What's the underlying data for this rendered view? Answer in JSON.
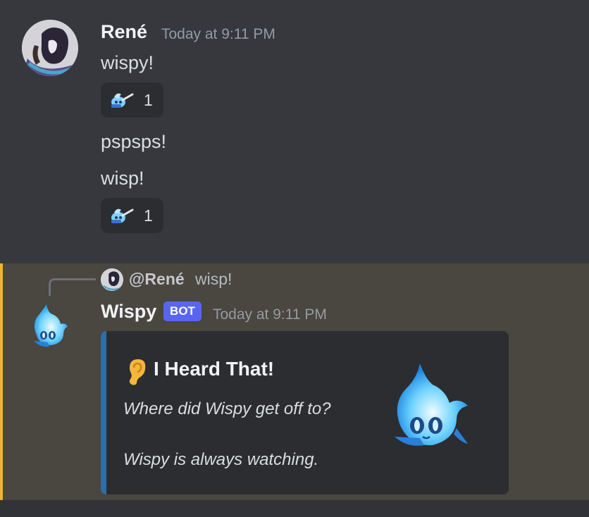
{
  "messages": [
    {
      "author": "René",
      "timestamp": "Today at 9:11 PM",
      "lines": [
        {
          "text": "wispy!",
          "reaction": {
            "emoji": "wisp-guitar-emoji",
            "count": "1"
          }
        },
        {
          "text": "pspsps!"
        },
        {
          "text": "wisp!",
          "reaction": {
            "emoji": "wisp-guitar-emoji",
            "count": "1"
          }
        }
      ]
    },
    {
      "author": "Wispy",
      "badge": "BOT",
      "timestamp": "Today at 9:11 PM",
      "reply": {
        "mention": "@René",
        "text": "wisp!"
      },
      "embed": {
        "title_emoji": "ear-emoji",
        "title": "I Heard That!",
        "description_lines": [
          "Where did Wispy get off to?",
          "Wispy is always watching."
        ],
        "thumbnail": "wispy-ghost-image",
        "accent_color": "#2d6fa6"
      }
    }
  ],
  "colors": {
    "highlight_bar": "#f0b232",
    "bot_badge": "#5865f2"
  }
}
